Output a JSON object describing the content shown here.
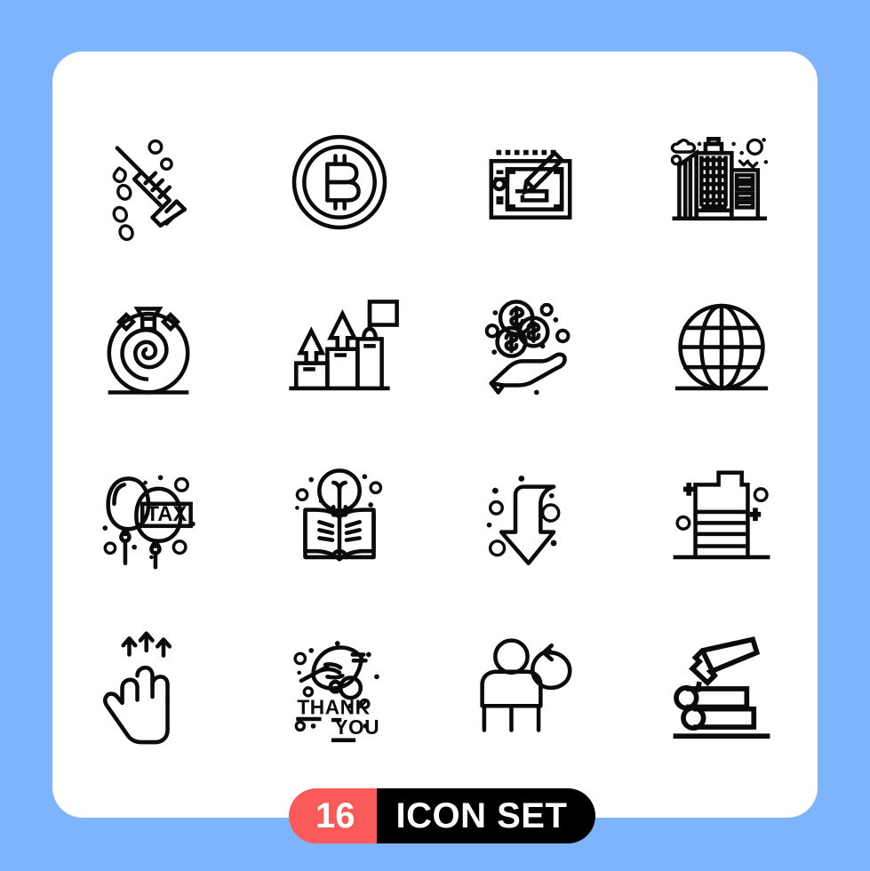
{
  "page": {
    "background_color": "#7db4fb",
    "card_color": "#ffffff"
  },
  "badge": {
    "count": "16",
    "label": "ICON SET",
    "count_bg_color": "#fb5a5a",
    "label_bg_color": "#000000",
    "text_color": "#ffffff"
  },
  "grid": {
    "columns": 4,
    "rows": 4,
    "stroke_color": "#0b0b0b",
    "icons": [
      {
        "position": 1,
        "name": "syringe-injection-icon",
        "label": "Syringe"
      },
      {
        "position": 2,
        "name": "bitcoin-coin-icon",
        "label": "Bitcoin"
      },
      {
        "position": 3,
        "name": "graphic-tablet-stylus-icon",
        "label": "Graphic Tablet"
      },
      {
        "position": 4,
        "name": "city-buildings-icon",
        "label": "Buildings"
      },
      {
        "position": 5,
        "name": "hypnosis-spiral-icon",
        "label": "Hypnosis"
      },
      {
        "position": 6,
        "name": "growth-stairs-flag-icon",
        "label": "Growth"
      },
      {
        "position": 7,
        "name": "hand-receiving-coins-icon",
        "label": "Donation"
      },
      {
        "position": 8,
        "name": "globe-grid-icon",
        "label": "Globe"
      },
      {
        "position": 9,
        "name": "tax-balloons-icon",
        "label": "Tax Balloons",
        "text": "TAX"
      },
      {
        "position": 10,
        "name": "book-lightbulb-icon",
        "label": "Knowledge"
      },
      {
        "position": 11,
        "name": "curved-down-arrow-icon",
        "label": "Down Arrow"
      },
      {
        "position": 12,
        "name": "battery-level-icon",
        "label": "Battery"
      },
      {
        "position": 13,
        "name": "three-finger-swipe-up-icon",
        "label": "Swipe Up Gesture"
      },
      {
        "position": 14,
        "name": "thank-you-leaf-icon",
        "label": "Thank You",
        "text_line1": "THANK",
        "text_line2": "YOU"
      },
      {
        "position": 15,
        "name": "user-return-arrow-icon",
        "label": "User Return"
      },
      {
        "position": 16,
        "name": "axe-logs-icon",
        "label": "Axe and Logs"
      }
    ]
  }
}
